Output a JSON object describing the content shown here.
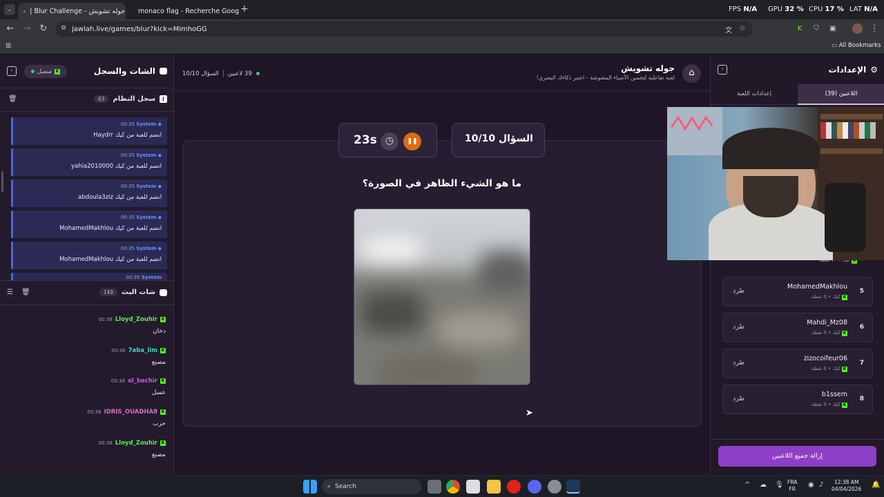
{
  "browser": {
    "tabs": [
      {
        "label": "جوله تشويش - Blur Challenge |"
      },
      {
        "label": "monaco flag - Recherche Goog"
      }
    ],
    "new_tab_symbol": "+",
    "url": "jawlah.live/games/blur?kick=MimhoGG",
    "bookmarks_label": "All Bookmarks",
    "stats": [
      {
        "label": "FPS",
        "value": "N/A"
      },
      {
        "label": "GPU",
        "value": "32 %"
      },
      {
        "label": "CPU",
        "value": "17 %"
      },
      {
        "label": "LAT",
        "value": "N/A"
      }
    ]
  },
  "left_panel": {
    "title": "الشات والسجل",
    "status_label": "متصل",
    "system_log": {
      "title": "سجل النظام",
      "count": "63",
      "messages": [
        {
          "time": "00:35",
          "sender": "System",
          "text": "Haydrr انضم للعبة من كيك"
        },
        {
          "time": "00:35",
          "sender": "System",
          "text": "yahia2010000 انضم للعبة من كيك"
        },
        {
          "time": "00:35",
          "sender": "System",
          "text": "abdoula3ziz انضم للعبة من كيك"
        },
        {
          "time": "00:35",
          "sender": "System",
          "text": "MohamedMakhlou انضم للعبة من كيك"
        },
        {
          "time": "00:35",
          "sender": "System",
          "text": "MohamedMakhlou انضم للعبة من كيك"
        },
        {
          "time": "00:35",
          "sender": "System",
          "text": ""
        }
      ]
    },
    "stream_chat": {
      "title": "شات البث",
      "count": "149",
      "messages": [
        {
          "time": "00:38",
          "user": "Lloyd_Zouhir",
          "color": "#5be85b",
          "text": "دخان"
        },
        {
          "time": "00:38",
          "user": "7aba_lim",
          "color": "#3fd6c8",
          "text": "مصنع"
        },
        {
          "time": "00:38",
          "user": "al_bachir",
          "color": "#c15ee0",
          "text": "عسل"
        },
        {
          "time": "00:38",
          "user": "IDRIS_OUADHA8",
          "color": "#d16bd0",
          "text": "حرب"
        },
        {
          "time": "00:38",
          "user": "Lloyd_Zouhir",
          "color": "#5be85b",
          "text": "مصنع"
        }
      ]
    }
  },
  "center": {
    "title": "جوله تشويش",
    "subtitle": "لعبة تفاعلية لتخمين الأشياء المشوشة - اختبر ذكاءك البصري!",
    "players_online": "39 لاعبين",
    "question_small": "السؤال 10/10",
    "question_card": "السؤال 10/10",
    "timer": "23s",
    "prompt": "ما هو الشيء الظاهر في الصورة؟"
  },
  "right_panel": {
    "title": "الإعدادات",
    "tabs": [
      {
        "label": "اللاعبين (39)"
      },
      {
        "label": "إعدادات اللعبة"
      }
    ],
    "partial_meta": "كيك • ١٠ نقطة",
    "players": [
      {
        "rank": "5",
        "name": "MohamedMakhlou",
        "meta": "كيك • 0 نقطة",
        "action": "طرد"
      },
      {
        "rank": "6",
        "name": "Mahdi_Mz08",
        "meta": "كيك • 0 نقطة",
        "action": "طرد"
      },
      {
        "rank": "7",
        "name": "zizocoifeur06",
        "meta": "كيك • 0 نقطة",
        "action": "طرد"
      },
      {
        "rank": "8",
        "name": "b1ssem",
        "meta": "كيك • 0 نقطة",
        "action": "طرد"
      }
    ],
    "remove_all_label": "إزالة جميع اللاعبين"
  },
  "taskbar": {
    "search_placeholder": "Search",
    "lang_top": "FRA",
    "lang_bottom": "FR",
    "time": "12:38 AM",
    "date": "04/04/2026"
  },
  "colors": {
    "accent_purple": "#8e3fc8",
    "timer_orange": "#e06a12",
    "online_green": "#2fd36b",
    "kick_green": "#53fc18"
  }
}
